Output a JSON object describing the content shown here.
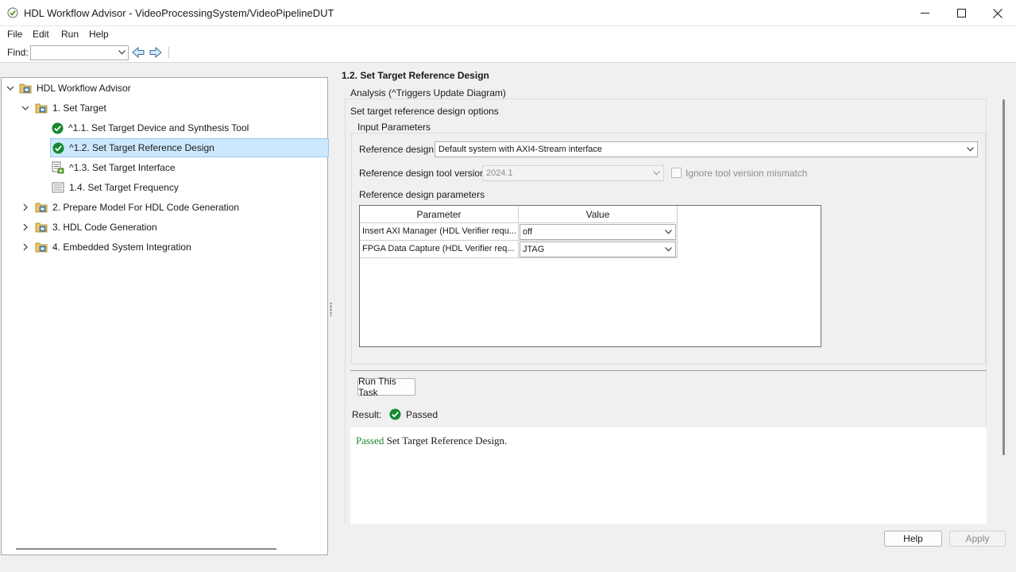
{
  "window": {
    "title": "HDL Workflow Advisor - VideoProcessingSystem/VideoPipelineDUT"
  },
  "menu": {
    "file": "File",
    "edit": "Edit",
    "run": "Run",
    "help": "Help"
  },
  "find": {
    "label": "Find:",
    "value": ""
  },
  "tree": {
    "root": "HDL Workflow Advisor",
    "set_target": "1. Set Target",
    "task_1_1": "^1.1. Set Target Device and Synthesis Tool",
    "task_1_2": "^1.2. Set Target Reference Design",
    "task_1_3": "^1.3. Set Target Interface",
    "task_1_4": "1.4. Set Target Frequency",
    "prepare": "2. Prepare Model For HDL Code Generation",
    "codegen": "3. HDL Code Generation",
    "embedded": "4. Embedded System Integration"
  },
  "panel": {
    "title": "1.2. Set Target Reference Design",
    "analysis_label": "Analysis (^Triggers Update Diagram)",
    "description": "Set target reference design options",
    "input_params_label": "Input Parameters",
    "ref_design_label": "Reference design:",
    "ref_design_value": "Default system with AXI4-Stream interface",
    "tool_version_label": "Reference design tool version:",
    "tool_version_value": "2024.1",
    "ignore_mismatch_label": "Ignore tool version mismatch",
    "params_label": "Reference design parameters",
    "table": {
      "col_param": "Parameter",
      "col_value": "Value",
      "rows": [
        {
          "param": "Insert AXI Manager (HDL Verifier requ...",
          "value": "off"
        },
        {
          "param": "FPGA Data Capture (HDL Verifier req...",
          "value": "JTAG"
        }
      ]
    },
    "run_button": "Run This Task",
    "result_label": "Result:",
    "result_status": "Passed",
    "result_passed": "Passed",
    "result_text": " Set Target Reference Design."
  },
  "footer": {
    "help": "Help",
    "apply": "Apply"
  },
  "colors": {
    "pass_green": "#15892e",
    "selection": "#cce8ff"
  }
}
